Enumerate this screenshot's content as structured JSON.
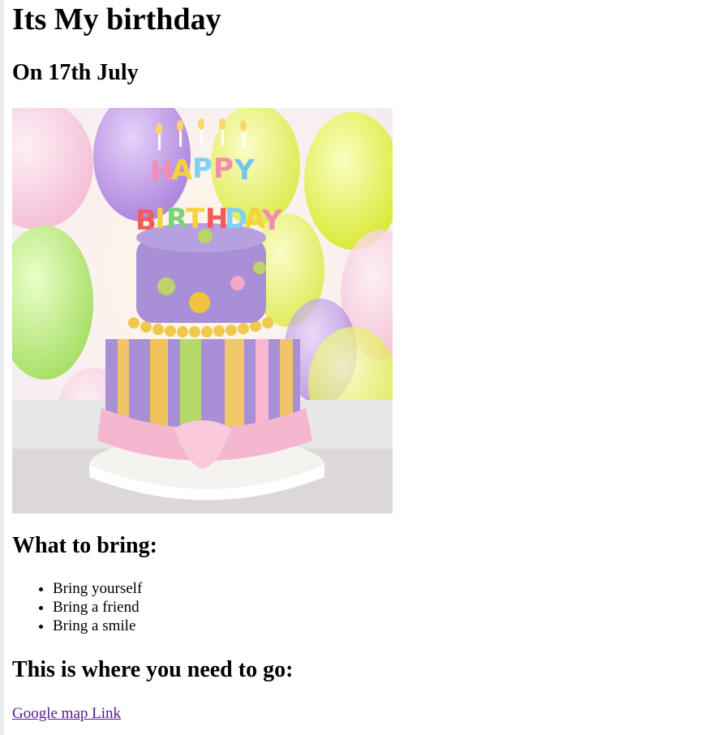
{
  "header": {
    "title": "Its My birthday",
    "subtitle": "On 17th July"
  },
  "image": {
    "icon": "birthday-cake-photo",
    "cake_topper_text": "HAPPY BIRTHDAY",
    "colors": {
      "cake_purple": "#a98fd6",
      "balloon_yellow": "#e9f05a",
      "balloon_purple": "#b48be0",
      "ribbon_pink": "#f5b6cf"
    }
  },
  "bring": {
    "heading": "What to bring:",
    "items": [
      "Bring yourself",
      "Bring a friend",
      "Bring a smile"
    ]
  },
  "location": {
    "heading": "This is where you need to go:",
    "link_text": "Google map Link"
  },
  "colors": {
    "link": "#551a8b"
  }
}
